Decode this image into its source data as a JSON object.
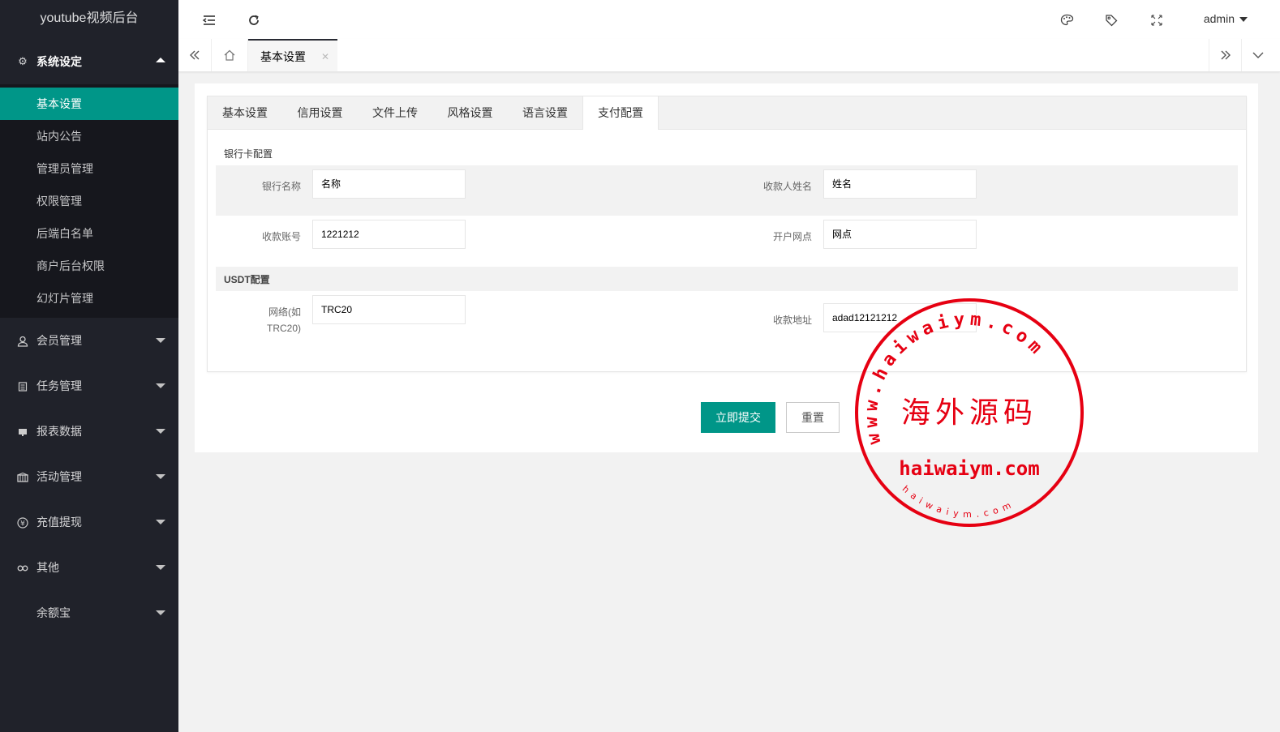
{
  "app": {
    "logo": "youtube视频后台"
  },
  "sidebar": {
    "open_group": {
      "label": "系统设定",
      "icon": "gear-icon"
    },
    "sub_items": [
      {
        "label": "基本设置",
        "active": true
      },
      {
        "label": "站内公告"
      },
      {
        "label": "管理员管理"
      },
      {
        "label": "权限管理"
      },
      {
        "label": "后端白名单"
      },
      {
        "label": "商户后台权限"
      },
      {
        "label": "幻灯片管理"
      }
    ],
    "groups": [
      {
        "label": "会员管理",
        "icon": "user-icon"
      },
      {
        "label": "任务管理",
        "icon": "list-icon"
      },
      {
        "label": "报表数据",
        "icon": "chart-icon"
      },
      {
        "label": "活动管理",
        "icon": "activity-icon"
      },
      {
        "label": "充值提现",
        "icon": "yen-icon"
      },
      {
        "label": "其他",
        "icon": "link-icon"
      },
      {
        "label": "余额宝",
        "icon": "none"
      }
    ]
  },
  "header": {
    "user": "admin"
  },
  "page_tabs": {
    "current": "基本设置"
  },
  "settings_tabs": [
    "基本设置",
    "信用设置",
    "文件上传",
    "风格设置",
    "语言设置",
    "支付配置"
  ],
  "form": {
    "bank_section": "银行卡配置",
    "bank_name_label": "银行名称",
    "bank_name_value": "名称",
    "payee_label": "收款人姓名",
    "payee_value": "姓名",
    "account_label": "收款账号",
    "account_value": "1221212",
    "branch_label": "开户网点",
    "branch_value": "网点",
    "usdt_section": "USDT配置",
    "network_label_1": "网络(如",
    "network_label_2": "TRC20)",
    "network_value": "TRC20",
    "address_label": "收款地址",
    "address_value": "adad12121212",
    "submit": "立即提交",
    "reset": "重置"
  },
  "watermark": {
    "top_arc": "www.haiwaiym.com",
    "center": "海外源码",
    "domain": "haiwaiym.com",
    "bottom_arc": "haiwaiym.com",
    "color": "#e60012"
  },
  "colors": {
    "sidebar": "#20222a",
    "accent": "#009688"
  }
}
